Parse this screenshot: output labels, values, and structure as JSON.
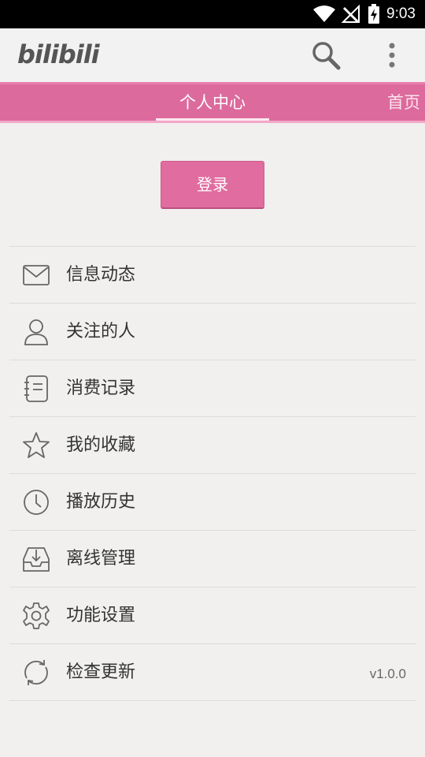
{
  "status_bar": {
    "time": "9:03"
  },
  "app_bar": {
    "logo_text": "bilibili",
    "search_icon": "search-icon",
    "overflow_icon": "more-vert-icon"
  },
  "tabs": [
    {
      "label": "个人中心",
      "selected": true
    },
    {
      "label": "首页",
      "selected": false
    }
  ],
  "login": {
    "label": "登录"
  },
  "menu": [
    {
      "label": "信息动态",
      "icon": "mail-icon"
    },
    {
      "label": "关注的人",
      "icon": "person-icon"
    },
    {
      "label": "消费记录",
      "icon": "notebook-icon"
    },
    {
      "label": "我的收藏",
      "icon": "star-icon"
    },
    {
      "label": "播放历史",
      "icon": "clock-icon"
    },
    {
      "label": "离线管理",
      "icon": "download-tray-icon"
    },
    {
      "label": "功能设置",
      "icon": "gear-icon"
    },
    {
      "label": "检查更新",
      "icon": "refresh-icon",
      "trailing": "v1.0.0"
    }
  ],
  "colors": {
    "accent": "#dd6a9c",
    "background": "#f1f0ef",
    "text": "#333333"
  }
}
